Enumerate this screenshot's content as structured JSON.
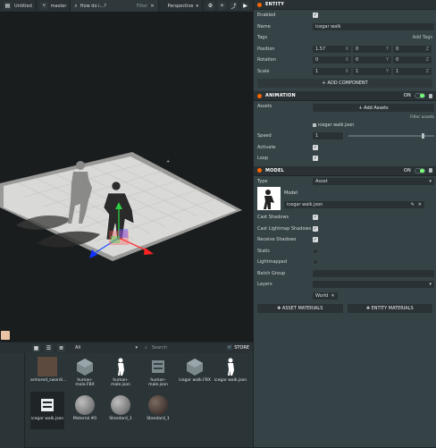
{
  "topbar": {
    "scene": "Untitled",
    "branch": "master",
    "search_placeholder": "How do i...?",
    "filter_label": "Filter",
    "camera": "Perspective"
  },
  "entity": {
    "header": "ENTITY",
    "enabled_label": "Enabled",
    "name_label": "Name",
    "name_value": "icegar walk",
    "tags_label": "Tags",
    "add_tags": "Add Tags",
    "position_label": "Position",
    "position": [
      "1.57",
      "0",
      "0"
    ],
    "rotation_label": "Rotation",
    "rotation": [
      "0",
      "0",
      "0"
    ],
    "scale_label": "Scale",
    "scale": [
      "1",
      "1",
      "1"
    ],
    "axes": [
      "X",
      "Y",
      "Z"
    ],
    "add_component": "ADD COMPONENT"
  },
  "animation": {
    "header": "ANIMATION",
    "on_label": "ON",
    "assets_label": "Assets",
    "add_assets": "+ Add Assets",
    "filter_assets": "Filter assets",
    "asset_item": "icegar walk.json",
    "speed_label": "Speed",
    "speed_value": "1",
    "speed_fraction": 0.85,
    "activate_label": "Activate",
    "loop_label": "Loop"
  },
  "model": {
    "header": "MODEL",
    "on_label": "ON",
    "type_label": "Type",
    "type_value": "Asset",
    "model_label": "Model",
    "model_value": "icegar walk.json",
    "cast_shadows_label": "Cast Shadows",
    "cast_lightmap_label": "Cast Lightmap Shadows",
    "receive_shadows_label": "Receive Shadows",
    "static_label": "Static",
    "lightmapped_label": "Lightmapped",
    "batch_group_label": "Batch Group",
    "layers_label": "Layers",
    "layer_tag": "World",
    "asset_materials": "ASSET MATERIALS",
    "entity_materials": "ENTITY MATERIALS"
  },
  "assets_panel": {
    "filter_value": "All",
    "search_placeholder": "Search",
    "store_label": "STORE",
    "items": [
      "armored_swordi...",
      "human-male.FBX",
      "human-male.json",
      "human-male.json",
      "icegar walk.FBX",
      "icegar walk.json",
      "icegar walk.json",
      "Material #0",
      "Standard_1",
      "Standard_1"
    ]
  },
  "colors": {
    "accent_orange": "#ff6600",
    "toggle_green": "#7dff77",
    "panel_bg": "#364346",
    "header_bg": "#293134"
  }
}
